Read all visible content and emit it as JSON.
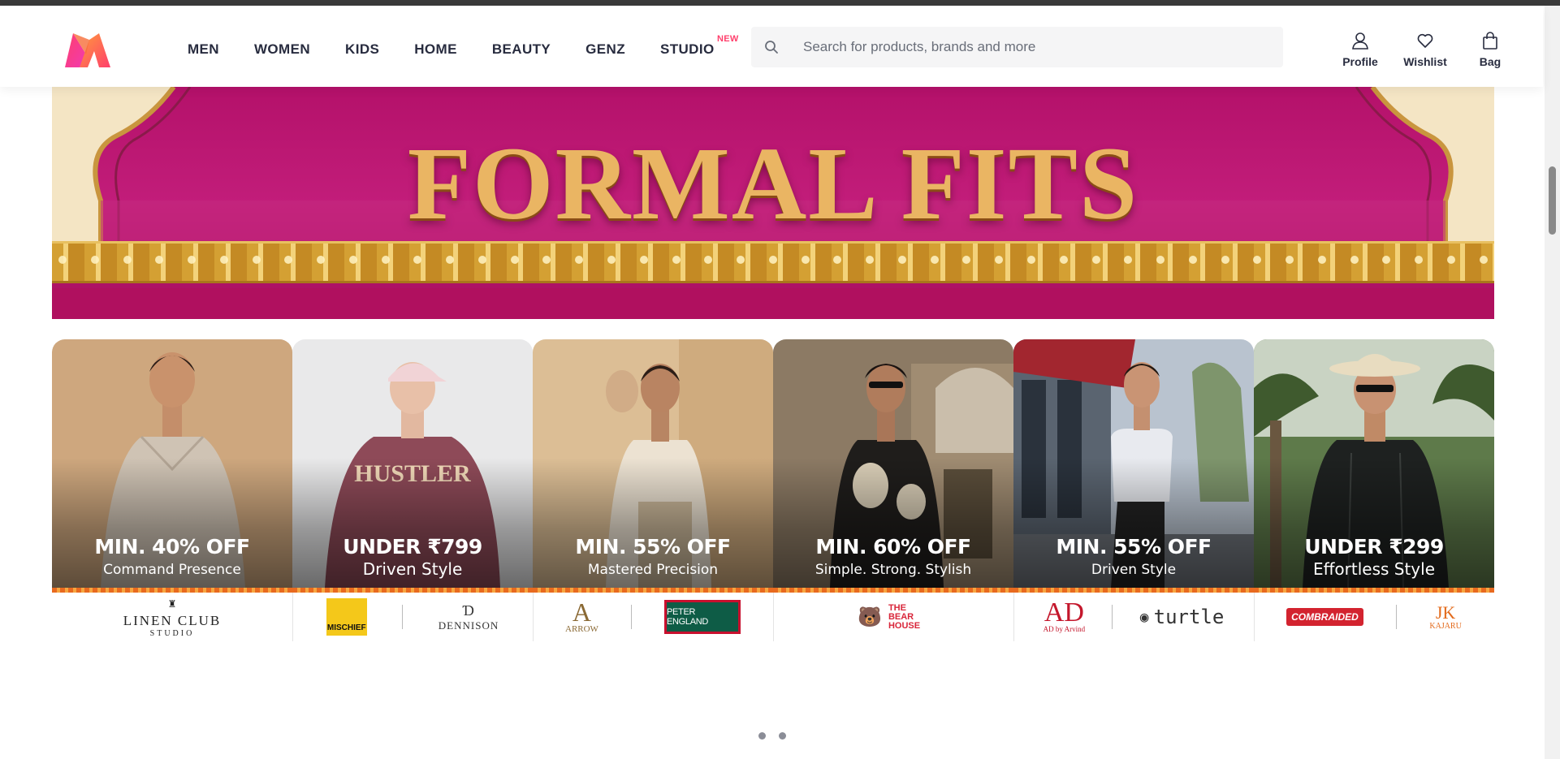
{
  "header": {
    "logo": "myntra-logo",
    "nav": [
      {
        "label": "MEN"
      },
      {
        "label": "WOMEN"
      },
      {
        "label": "KIDS"
      },
      {
        "label": "HOME"
      },
      {
        "label": "BEAUTY"
      },
      {
        "label": "GENZ"
      },
      {
        "label": "STUDIO",
        "badge": "NEW"
      }
    ],
    "search": {
      "placeholder": "Search for products, brands and more",
      "value": ""
    },
    "actions": {
      "profile": "Profile",
      "wishlist": "Wishlist",
      "bag": "Bag"
    }
  },
  "banner": {
    "title": "FORMAL FITS"
  },
  "cards": [
    {
      "offer": "MIN. 40% OFF",
      "tagline": "Command Presence",
      "brands": [
        "LINEN CLUB",
        "STUDIO"
      ]
    },
    {
      "offer": "UNDER ₹799",
      "tagline": "Driven Style",
      "brands": [
        "MISCHIEF",
        "DENNISON"
      ]
    },
    {
      "offer": "MIN. 55% OFF",
      "tagline": "Mastered Precision",
      "brands": [
        "ARROW",
        "PETER ENGLAND"
      ]
    },
    {
      "offer": "MIN. 60% OFF",
      "tagline": "Simple. Strong. Stylish",
      "brands": [
        "THE BEAR HOUSE"
      ]
    },
    {
      "offer": "MIN. 55% OFF",
      "tagline": "Driven Style",
      "brands": [
        "AD by Arvind",
        "turtle"
      ]
    },
    {
      "offer": "UNDER ₹299",
      "tagline": "Effortless Style",
      "brands": [
        "COMBRAIDED",
        "KAJARU"
      ]
    }
  ],
  "carousel": {
    "active_index": 0,
    "count": 2
  },
  "colors": {
    "brand_pink": "#ff3f6c",
    "text_dark": "#282c3f",
    "banner_magenta": "#b4116a",
    "banner_gold": "#eab563"
  }
}
